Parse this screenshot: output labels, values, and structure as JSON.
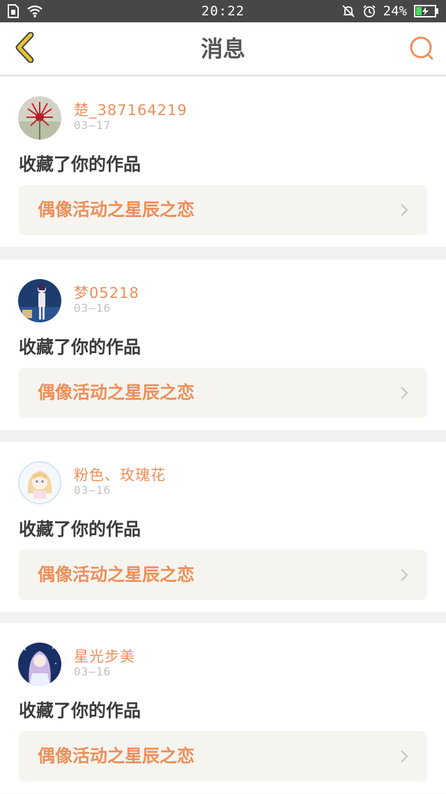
{
  "status_bar": {
    "time": "20:22",
    "battery": "24%",
    "icons_left": [
      "sim-icon",
      "wifi-icon"
    ],
    "icons_right": [
      "mute-icon",
      "alarm-icon",
      "battery-icon"
    ]
  },
  "header": {
    "title": "消息",
    "back_icon": "chevron-left-icon",
    "search_icon": "search-icon"
  },
  "colors": {
    "accent": "#ee8f5a",
    "back_icon": "#e6c431",
    "status_bar_bg": "#474747",
    "card_bg": "#ffffff",
    "page_bg": "#f2f2f0",
    "link_bg": "#f5f4ef"
  },
  "messages": [
    {
      "user": "楚_387164219",
      "date": "03—17",
      "action": "收藏了你的作品",
      "work": "偶像活动之星辰之恋",
      "avatar": "red-flower-avatar"
    },
    {
      "user": "梦05218",
      "date": "03—16",
      "action": "收藏了你的作品",
      "work": "偶像活动之星辰之恋",
      "avatar": "blue-character-avatar"
    },
    {
      "user": "粉色、玫瑰花",
      "date": "03—16",
      "action": "收藏了你的作品",
      "work": "偶像活动之星辰之恋",
      "avatar": "anime-girl-avatar"
    },
    {
      "user": "星光步美",
      "date": "03—16",
      "action": "收藏了你的作品",
      "work": "偶像活动之星辰之恋",
      "avatar": "night-girl-avatar"
    }
  ]
}
